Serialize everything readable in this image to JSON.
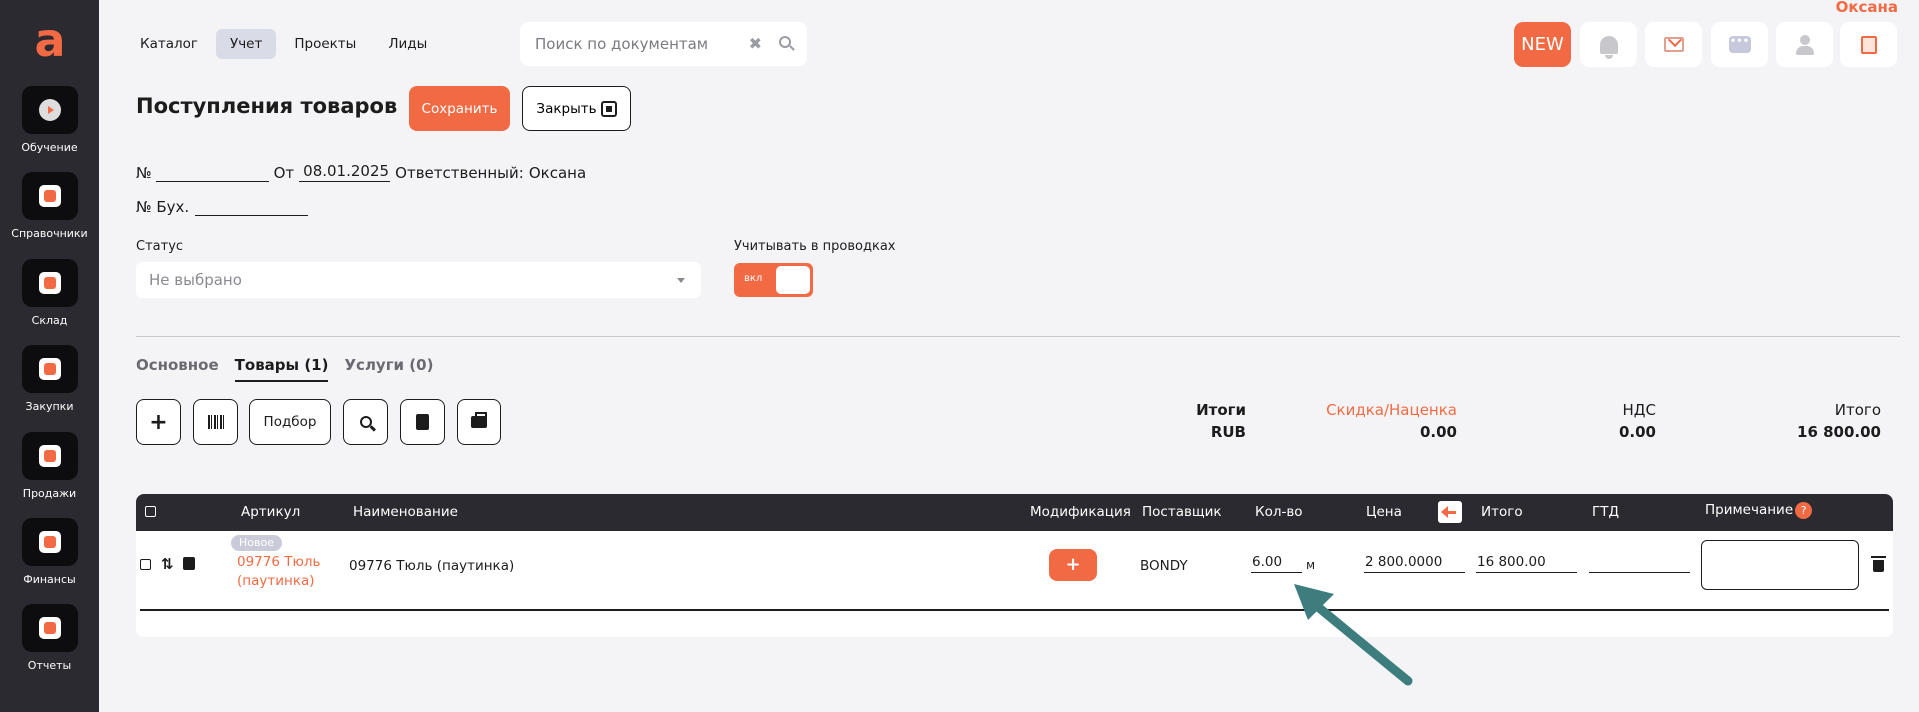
{
  "brand": {
    "logo_letter": "a",
    "accent": "#f26a44"
  },
  "sidebar": {
    "items": [
      {
        "label": "Обучение",
        "icon": "play-icon"
      },
      {
        "label": "Справочники",
        "icon": "book-icon"
      },
      {
        "label": "Склад",
        "icon": "warehouse-icon"
      },
      {
        "label": "Закупки",
        "icon": "purchase-icon"
      },
      {
        "label": "Продажи",
        "icon": "tag-icon"
      },
      {
        "label": "Финансы",
        "icon": "finance-icon"
      },
      {
        "label": "Отчеты",
        "icon": "report-icon"
      }
    ]
  },
  "topnav": {
    "tabs": [
      {
        "label": "Каталог"
      },
      {
        "label": "Учет",
        "active": true
      },
      {
        "label": "Проекты"
      },
      {
        "label": "Лиды"
      }
    ]
  },
  "search": {
    "placeholder": "Поиск по документам",
    "value": ""
  },
  "header_right": {
    "user_name": "Оксана",
    "new_label": "NEW"
  },
  "page": {
    "title": "Поступления товаров",
    "save_label": "Сохранить",
    "close_label": "Закрыть"
  },
  "form": {
    "number_label": "№",
    "number_value": "",
    "date_label": "От",
    "date_value": "08.01.2025",
    "responsible_label": "Ответственный:",
    "responsible_value": "Оксана",
    "acc_number_label": "№ Бух.",
    "acc_number_value": "",
    "status_label": "Статус",
    "status_value": "Не выбрано",
    "posting_label": "Учитывать в проводках",
    "posting_toggle": "вкл"
  },
  "tabs": [
    {
      "label": "Основное"
    },
    {
      "label": "Товары (1)",
      "active": true
    },
    {
      "label": "Услуги (0)"
    }
  ],
  "toolbar": {
    "select_label": "Подбор"
  },
  "totals": {
    "label_top": "Итоги",
    "label_bottom": "RUB",
    "discount_label": "Скидка/Наценка",
    "discount_value": "0.00",
    "vat_label": "НДС",
    "vat_value": "0.00",
    "total_label": "Итого",
    "total_value": "16 800.00"
  },
  "table": {
    "columns": {
      "article": "Артикул",
      "name": "Наименование",
      "modification": "Модификация",
      "supplier": "Поставщик",
      "qty": "Кол-во",
      "price": "Цена",
      "total": "Итого",
      "gtd": "ГТД",
      "note": "Примечание",
      "help": "?"
    },
    "rows": [
      {
        "badge": "Новое",
        "article": "09776 Тюль (паутинка)",
        "name": "09776 Тюль (паутинка)",
        "modification_button": "+",
        "supplier": "BONDY",
        "qty": "6.00",
        "unit": "м",
        "price": "2 800.0000",
        "total": "16 800.00",
        "gtd": "",
        "note": ""
      }
    ]
  },
  "annotation": {
    "arrow_color": "#3d7d7d"
  }
}
